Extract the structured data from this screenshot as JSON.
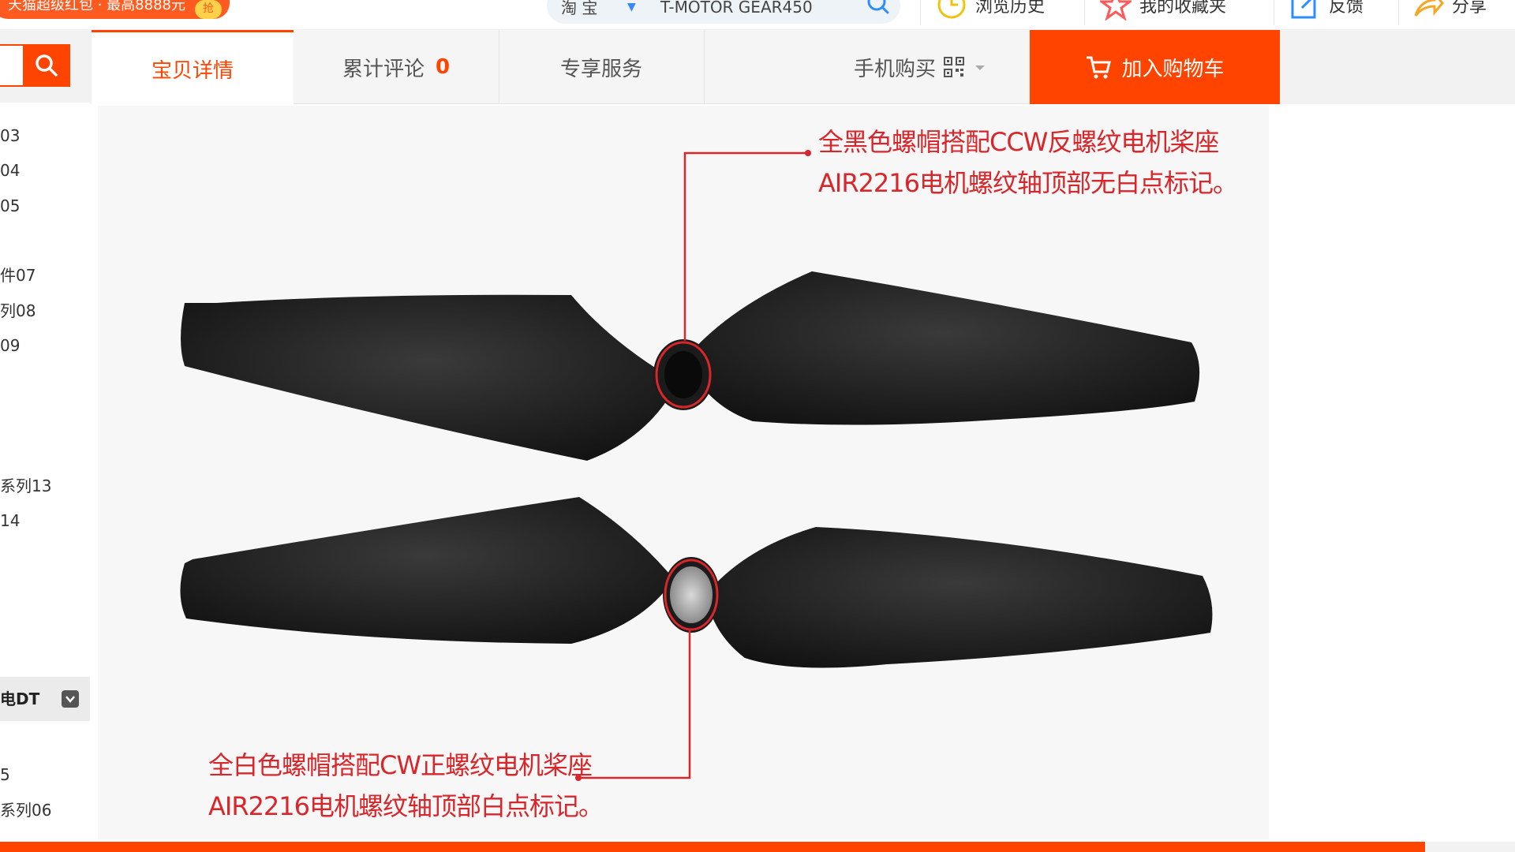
{
  "promo": {
    "text": "天猫超级红包 · 最高8888元",
    "badge": "抢"
  },
  "search": {
    "scope": "淘 宝",
    "query": "T-MOTOR GEAR450"
  },
  "toolbar": {
    "history": "浏览历史",
    "favorites": "我的收藏夹",
    "feedback": "反馈",
    "share": "分享"
  },
  "sidebar": {
    "items": [
      "03",
      "04",
      "05",
      "件07",
      "列08",
      "09",
      "系列13",
      "14",
      "5",
      "系列06"
    ],
    "active": "电DT"
  },
  "tabs": {
    "detail": "宝贝详情",
    "reviews": "累计评论",
    "review_count": "0",
    "service": "专享服务",
    "mobile_buy": "手机购买"
  },
  "cart": {
    "label": "加入购物车"
  },
  "annotations": {
    "top_line1": "全黑色螺帽搭配CCW反螺纹电机桨座",
    "top_line2": "AIR2216电机螺纹轴顶部无白点标记。",
    "bottom_line1": "全白色螺帽搭配CW正螺纹电机桨座",
    "bottom_line2": "AIR2216电机螺纹轴顶部白点标记。"
  },
  "colors": {
    "accent": "#ff4400",
    "annotation": "#d8262a"
  }
}
